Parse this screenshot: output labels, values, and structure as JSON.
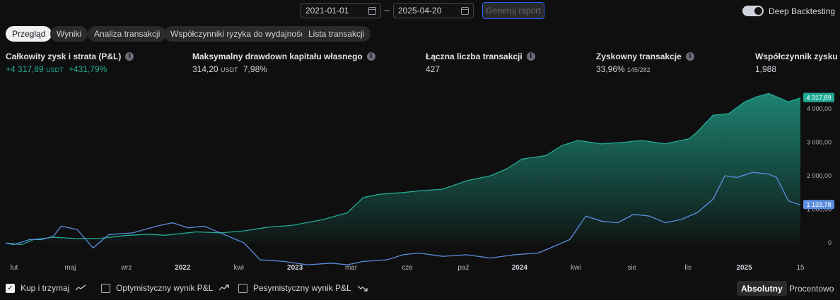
{
  "toolbar": {
    "start_date": "2021-01-01",
    "separator": "–",
    "end_date": "2025-04-20",
    "generate_label": "Generuj raport",
    "deep_label": "Deep Backtesting",
    "deep_enabled": true
  },
  "tabs": [
    {
      "label": "Przegląd",
      "active": true
    },
    {
      "label": "Wyniki",
      "active": false
    },
    {
      "label": "Analiza transakcji",
      "active": false
    },
    {
      "label": "Współczynniki ryzyka do wydajności",
      "active": false
    },
    {
      "label": "Lista transakcji",
      "active": false
    }
  ],
  "metrics": {
    "pnl": {
      "title": "Całkowity zysk i strata (P&L)",
      "value": "+4 317,89",
      "unit": "USDT",
      "pct": "+431,79%"
    },
    "drawdown": {
      "title": "Maksymalny drawdown kapitału własnego",
      "value": "314,20",
      "unit": "USDT",
      "pct": "7,98%"
    },
    "trades": {
      "title": "Łączna liczba transakcji",
      "value": "427"
    },
    "profitable": {
      "title": "Zyskowny transakcje",
      "value": "33,96%",
      "sub": "145/282"
    },
    "profit_factor": {
      "title": "Współczynnik zysku",
      "value": "1,988"
    }
  },
  "info_glyph": "i",
  "chart_data": {
    "type": "area",
    "x_ticks": [
      {
        "label": "lut",
        "bold": false
      },
      {
        "label": "maj",
        "bold": false
      },
      {
        "label": "wrz",
        "bold": false
      },
      {
        "label": "2022",
        "bold": true
      },
      {
        "label": "kwi",
        "bold": false
      },
      {
        "label": "2023",
        "bold": true
      },
      {
        "label": "mar",
        "bold": false
      },
      {
        "label": "cze",
        "bold": false
      },
      {
        "label": "paź",
        "bold": false
      },
      {
        "label": "2024",
        "bold": true
      },
      {
        "label": "kwi",
        "bold": false
      },
      {
        "label": "sie",
        "bold": false
      },
      {
        "label": "lis",
        "bold": false
      },
      {
        "label": "2025",
        "bold": true
      },
      {
        "label": "15",
        "bold": false
      }
    ],
    "y_ticks": [
      "0",
      "1 000,00",
      "2 000,00",
      "3 000,00",
      "4 000,00"
    ],
    "ylim": [
      -500,
      4500
    ],
    "xlim": [
      0,
      1
    ],
    "series": [
      {
        "key": "strategy",
        "color": "#22ab94",
        "last_label": "4 317,89",
        "points": [
          [
            0,
            0
          ],
          [
            0.02,
            -50
          ],
          [
            0.035,
            100
          ],
          [
            0.06,
            170
          ],
          [
            0.09,
            130
          ],
          [
            0.12,
            140
          ],
          [
            0.15,
            220
          ],
          [
            0.18,
            260
          ],
          [
            0.2,
            230
          ],
          [
            0.24,
            330
          ],
          [
            0.27,
            300
          ],
          [
            0.3,
            360
          ],
          [
            0.33,
            470
          ],
          [
            0.36,
            520
          ],
          [
            0.4,
            700
          ],
          [
            0.43,
            900
          ],
          [
            0.45,
            1350
          ],
          [
            0.47,
            1450
          ],
          [
            0.5,
            1500
          ],
          [
            0.52,
            1550
          ],
          [
            0.55,
            1600
          ],
          [
            0.58,
            1850
          ],
          [
            0.61,
            2000
          ],
          [
            0.63,
            2200
          ],
          [
            0.65,
            2500
          ],
          [
            0.68,
            2600
          ],
          [
            0.7,
            2900
          ],
          [
            0.72,
            3050
          ],
          [
            0.75,
            2950
          ],
          [
            0.78,
            3000
          ],
          [
            0.8,
            3050
          ],
          [
            0.83,
            2950
          ],
          [
            0.86,
            3100
          ],
          [
            0.87,
            3300
          ],
          [
            0.89,
            3800
          ],
          [
            0.91,
            3850
          ],
          [
            0.93,
            4200
          ],
          [
            0.945,
            4350
          ],
          [
            0.96,
            4450
          ],
          [
            0.975,
            4300
          ],
          [
            0.985,
            4200
          ],
          [
            1,
            4317.89
          ]
        ]
      },
      {
        "key": "buy_hold",
        "color": "#5b8ee0",
        "name": "Kup i trzymaj",
        "last_label": "1 133,78",
        "points": [
          [
            0,
            0
          ],
          [
            0.01,
            -50
          ],
          [
            0.03,
            100
          ],
          [
            0.045,
            100
          ],
          [
            0.06,
            200
          ],
          [
            0.07,
            500
          ],
          [
            0.09,
            400
          ],
          [
            0.11,
            -150
          ],
          [
            0.13,
            250
          ],
          [
            0.16,
            300
          ],
          [
            0.19,
            500
          ],
          [
            0.21,
            600
          ],
          [
            0.23,
            450
          ],
          [
            0.25,
            500
          ],
          [
            0.28,
            200
          ],
          [
            0.3,
            0
          ],
          [
            0.32,
            -500
          ],
          [
            0.35,
            -550
          ],
          [
            0.38,
            -650
          ],
          [
            0.41,
            -600
          ],
          [
            0.43,
            -650
          ],
          [
            0.45,
            -550
          ],
          [
            0.48,
            -500
          ],
          [
            0.5,
            -350
          ],
          [
            0.52,
            -300
          ],
          [
            0.55,
            -400
          ],
          [
            0.58,
            -350
          ],
          [
            0.61,
            -450
          ],
          [
            0.64,
            -350
          ],
          [
            0.67,
            -300
          ],
          [
            0.69,
            -100
          ],
          [
            0.71,
            100
          ],
          [
            0.73,
            800
          ],
          [
            0.75,
            650
          ],
          [
            0.77,
            600
          ],
          [
            0.79,
            850
          ],
          [
            0.81,
            800
          ],
          [
            0.83,
            600
          ],
          [
            0.85,
            700
          ],
          [
            0.87,
            900
          ],
          [
            0.89,
            1300
          ],
          [
            0.905,
            2000
          ],
          [
            0.92,
            1950
          ],
          [
            0.94,
            2100
          ],
          [
            0.96,
            2050
          ],
          [
            0.97,
            1950
          ],
          [
            0.985,
            1250
          ],
          [
            1,
            1133.78
          ]
        ]
      }
    ],
    "grid": false
  },
  "bottom": {
    "buy_hold": {
      "label": "Kup i trzymaj",
      "checked": true,
      "check_glyph": "✓"
    },
    "optimistic": {
      "label": "Optymistyczny wynik P&L",
      "checked": false
    },
    "pessimistic": {
      "label": "Pesymistyczny wynik P&L",
      "checked": false
    },
    "modes": [
      {
        "label": "Absolutny",
        "active": true
      },
      {
        "label": "Procentowo",
        "active": false
      }
    ]
  }
}
